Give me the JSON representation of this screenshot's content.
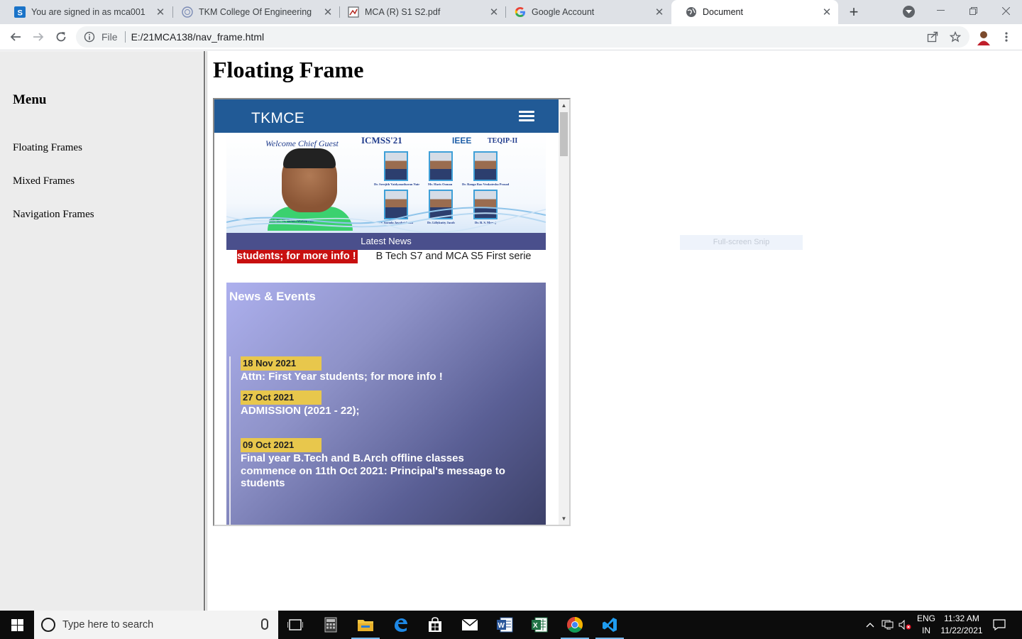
{
  "browser": {
    "tabs": [
      {
        "label": "You are signed in as mca001",
        "icon": "s-app-icon"
      },
      {
        "label": "TKM College Of Engineering",
        "icon": "college-seal-icon"
      },
      {
        "label": "MCA (R) S1 S2.pdf",
        "icon": "pdf-icon"
      },
      {
        "label": "Google Account",
        "icon": "google-icon"
      },
      {
        "label": "Document",
        "icon": "globe-icon",
        "active": true
      }
    ],
    "address": {
      "scheme": "File",
      "url": "E:/21MCA138/nav_frame.html"
    }
  },
  "left_frame": {
    "heading": "Menu",
    "links": [
      "Floating Frames",
      "Mixed Frames",
      "Navigation Frames"
    ]
  },
  "right_frame": {
    "title": "Floating Frame",
    "iframe": {
      "brand": "TKMCE",
      "banner": {
        "welcome": "Welcome Chief Guest",
        "guest_name": "Sri. K. N. BALAGOPAL",
        "event": "ICMSS'21",
        "sponsor1": "IEEE",
        "sponsor2": "TEQIP-II",
        "speakers": [
          "Dr. Sreejith Vaidyanatharan Nair",
          "Mr. Haris Ooman",
          "Dr. Ranga Rao Venkatesha Prasad",
          "Er. Sarada Jayakrishnan",
          "Dr. Lillykutty Jacob",
          "Dr. B. S. Manoj"
        ]
      },
      "latest_news_label": "Latest News",
      "ticker": {
        "highlight": "students; for more info !",
        "text": "B Tech S7 and MCA S5 First serie"
      },
      "news_title": "News & Events",
      "events": [
        {
          "date": "18 Nov 2021",
          "text": "Attn: First Year students; for more info !"
        },
        {
          "date": "27 Oct 2021",
          "text": "ADMISSION (2021 - 22);"
        },
        {
          "date": "09 Oct 2021",
          "text": "Final year B.Tech and B.Arch offline classes commence on 11th Oct 2021: Principal's message to students"
        }
      ]
    }
  },
  "snip_overlay": "Full-screen Snip",
  "taskbar": {
    "search_placeholder": "Type here to search",
    "lang_top": "ENG",
    "lang_bottom": "IN",
    "time": "11:32 AM",
    "date": "11/22/2021"
  },
  "colors": {
    "tkmce_header": "#215a96",
    "latest_news_bar": "#4a4f8c",
    "ticker_highlight": "#c80f0f",
    "event_date_tag": "#e8c74c"
  }
}
